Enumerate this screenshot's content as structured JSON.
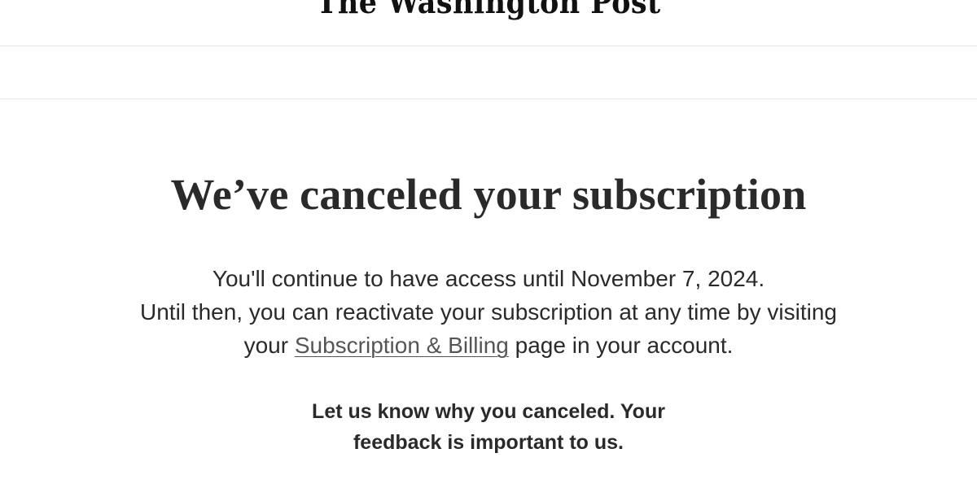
{
  "header": {
    "logo_text": "The Washington Post"
  },
  "main": {
    "headline": "We’ve canceled your subscription",
    "access_line": "You'll continue to have access until November 7, 2024.",
    "reactivate_line": "Until then, you can reactivate your subscription at any time by visiting",
    "link_prefix": "your",
    "billing_link": "Subscription & Billing",
    "link_suffix": "page in your account.",
    "feedback_line_1": "Let us know why you canceled. Your",
    "feedback_line_2": "feedback is important to us."
  }
}
